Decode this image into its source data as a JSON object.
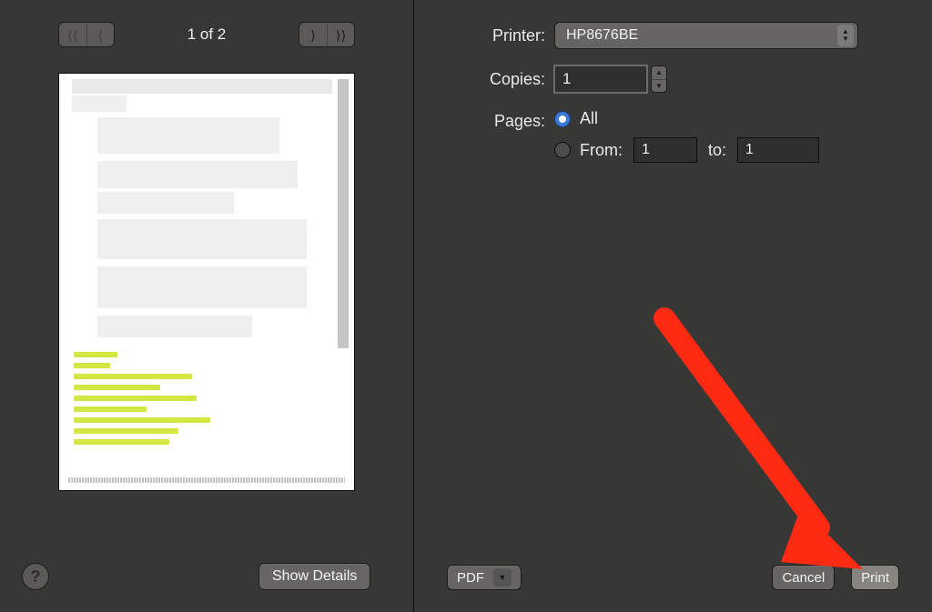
{
  "preview": {
    "page_indicator": "1 of 2",
    "show_details_label": "Show Details"
  },
  "options": {
    "printer_label": "Printer:",
    "printer_value": "HP8676BE",
    "copies_label": "Copies:",
    "copies_value": "1",
    "pages_label": "Pages:",
    "pages_all_label": "All",
    "pages_from_label": "From:",
    "pages_from_value": "1",
    "pages_to_label": "to:",
    "pages_to_value": "1"
  },
  "footer": {
    "pdf_label": "PDF",
    "cancel_label": "Cancel",
    "print_label": "Print"
  }
}
